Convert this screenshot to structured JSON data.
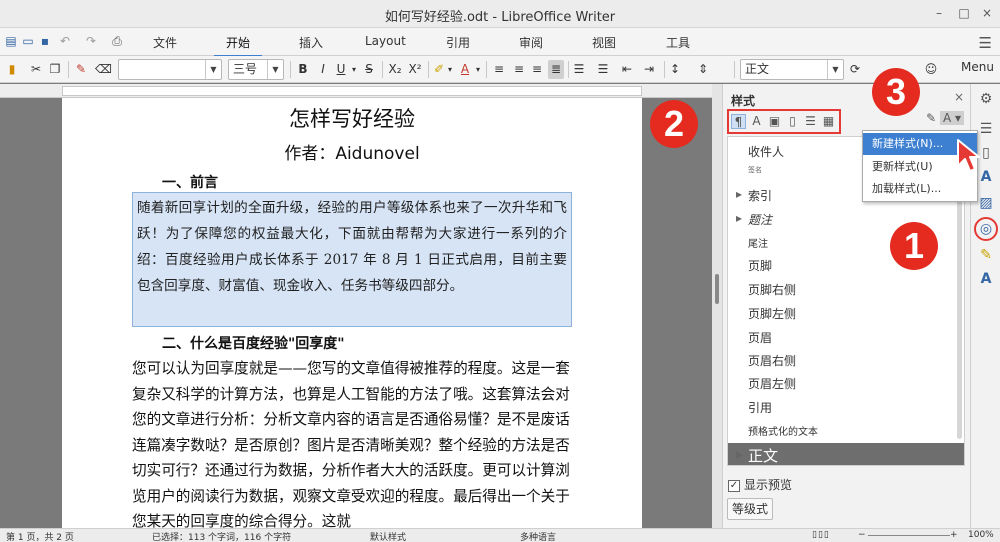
{
  "window": {
    "title": "如何写好经验.odt - LibreOffice Writer",
    "controls": [
      "–",
      "□",
      "×"
    ]
  },
  "tabs": {
    "items": [
      "文件",
      "开始",
      "插入",
      "Layout",
      "引用",
      "审阅",
      "视图",
      "工具"
    ],
    "active": "开始"
  },
  "toolbar": {
    "font_name": "",
    "font_size": "三号",
    "bold": "B",
    "italic": "I",
    "underline": "U",
    "strikethrough": "S",
    "subscript": "X₂",
    "superscript": "X²",
    "font_color": "A",
    "paragraph_style": "正文",
    "menu_label": "Menu"
  },
  "document": {
    "title": "怎样写好经验",
    "author": "作者：Aidunovel",
    "heading1": "一、前言",
    "selected_paragraph": "随着新回享计划的全面升级，经验的用户等级体系也来了一次升华和飞跃！为了保障您的权益最大化，下面就由帮帮为大家进行一系列的介绍：百度经验用户成长体系于 2017 年 8 月 1 日正式启用，目前主要包含回享度、财富值、现金收入、任务书等级四部分。",
    "heading2": "二、什么是百度经验\"回享度\"",
    "body_paragraph": "您可以认为回享度就是——您写的文章值得被推荐的程度。这是一套复杂又科学的计算方法，也算是人工智能的方法了哦。这套算法会对您的文章进行分析：分析文章内容的语言是否通俗易懂？是不是废话连篇凑字数哒？是否原创？图片是否清晰美观？整个经验的方法是否切实可行？还通过行为数据，分析作者大大的活跃度。更可以计算浏览用户的阅读行为数据，观察文章受欢迎的程度。最后得出一个关于您某天的回享度的综合得分。这就"
  },
  "sidebar": {
    "title": "样式",
    "close": "×",
    "styles": [
      "收件人",
      "签名",
      "索引",
      "题注",
      "尾注",
      "页脚",
      "页脚右侧",
      "页脚左侧",
      "页眉",
      "页眉右侧",
      "页眉左侧",
      "引用",
      "预格式化的文本",
      "正文"
    ],
    "show_preview": "显示预览",
    "level_button": "等级式"
  },
  "context_menu": {
    "items": [
      "新建样式(N)...",
      "更新样式(U)",
      "加载样式(L)..."
    ]
  },
  "markers": {
    "one": "1",
    "two": "2",
    "three": "3"
  },
  "statusbar": {
    "page": "第 1 页，共 2 页",
    "selection": "已选择：113 个字词，116 个字符",
    "page_style": "默认样式",
    "language": "多种语言",
    "zoom": "100%"
  },
  "colors": {
    "accent": "#3d7fd1",
    "marker": "#e52b1f",
    "selection": "#d6e4f5"
  }
}
